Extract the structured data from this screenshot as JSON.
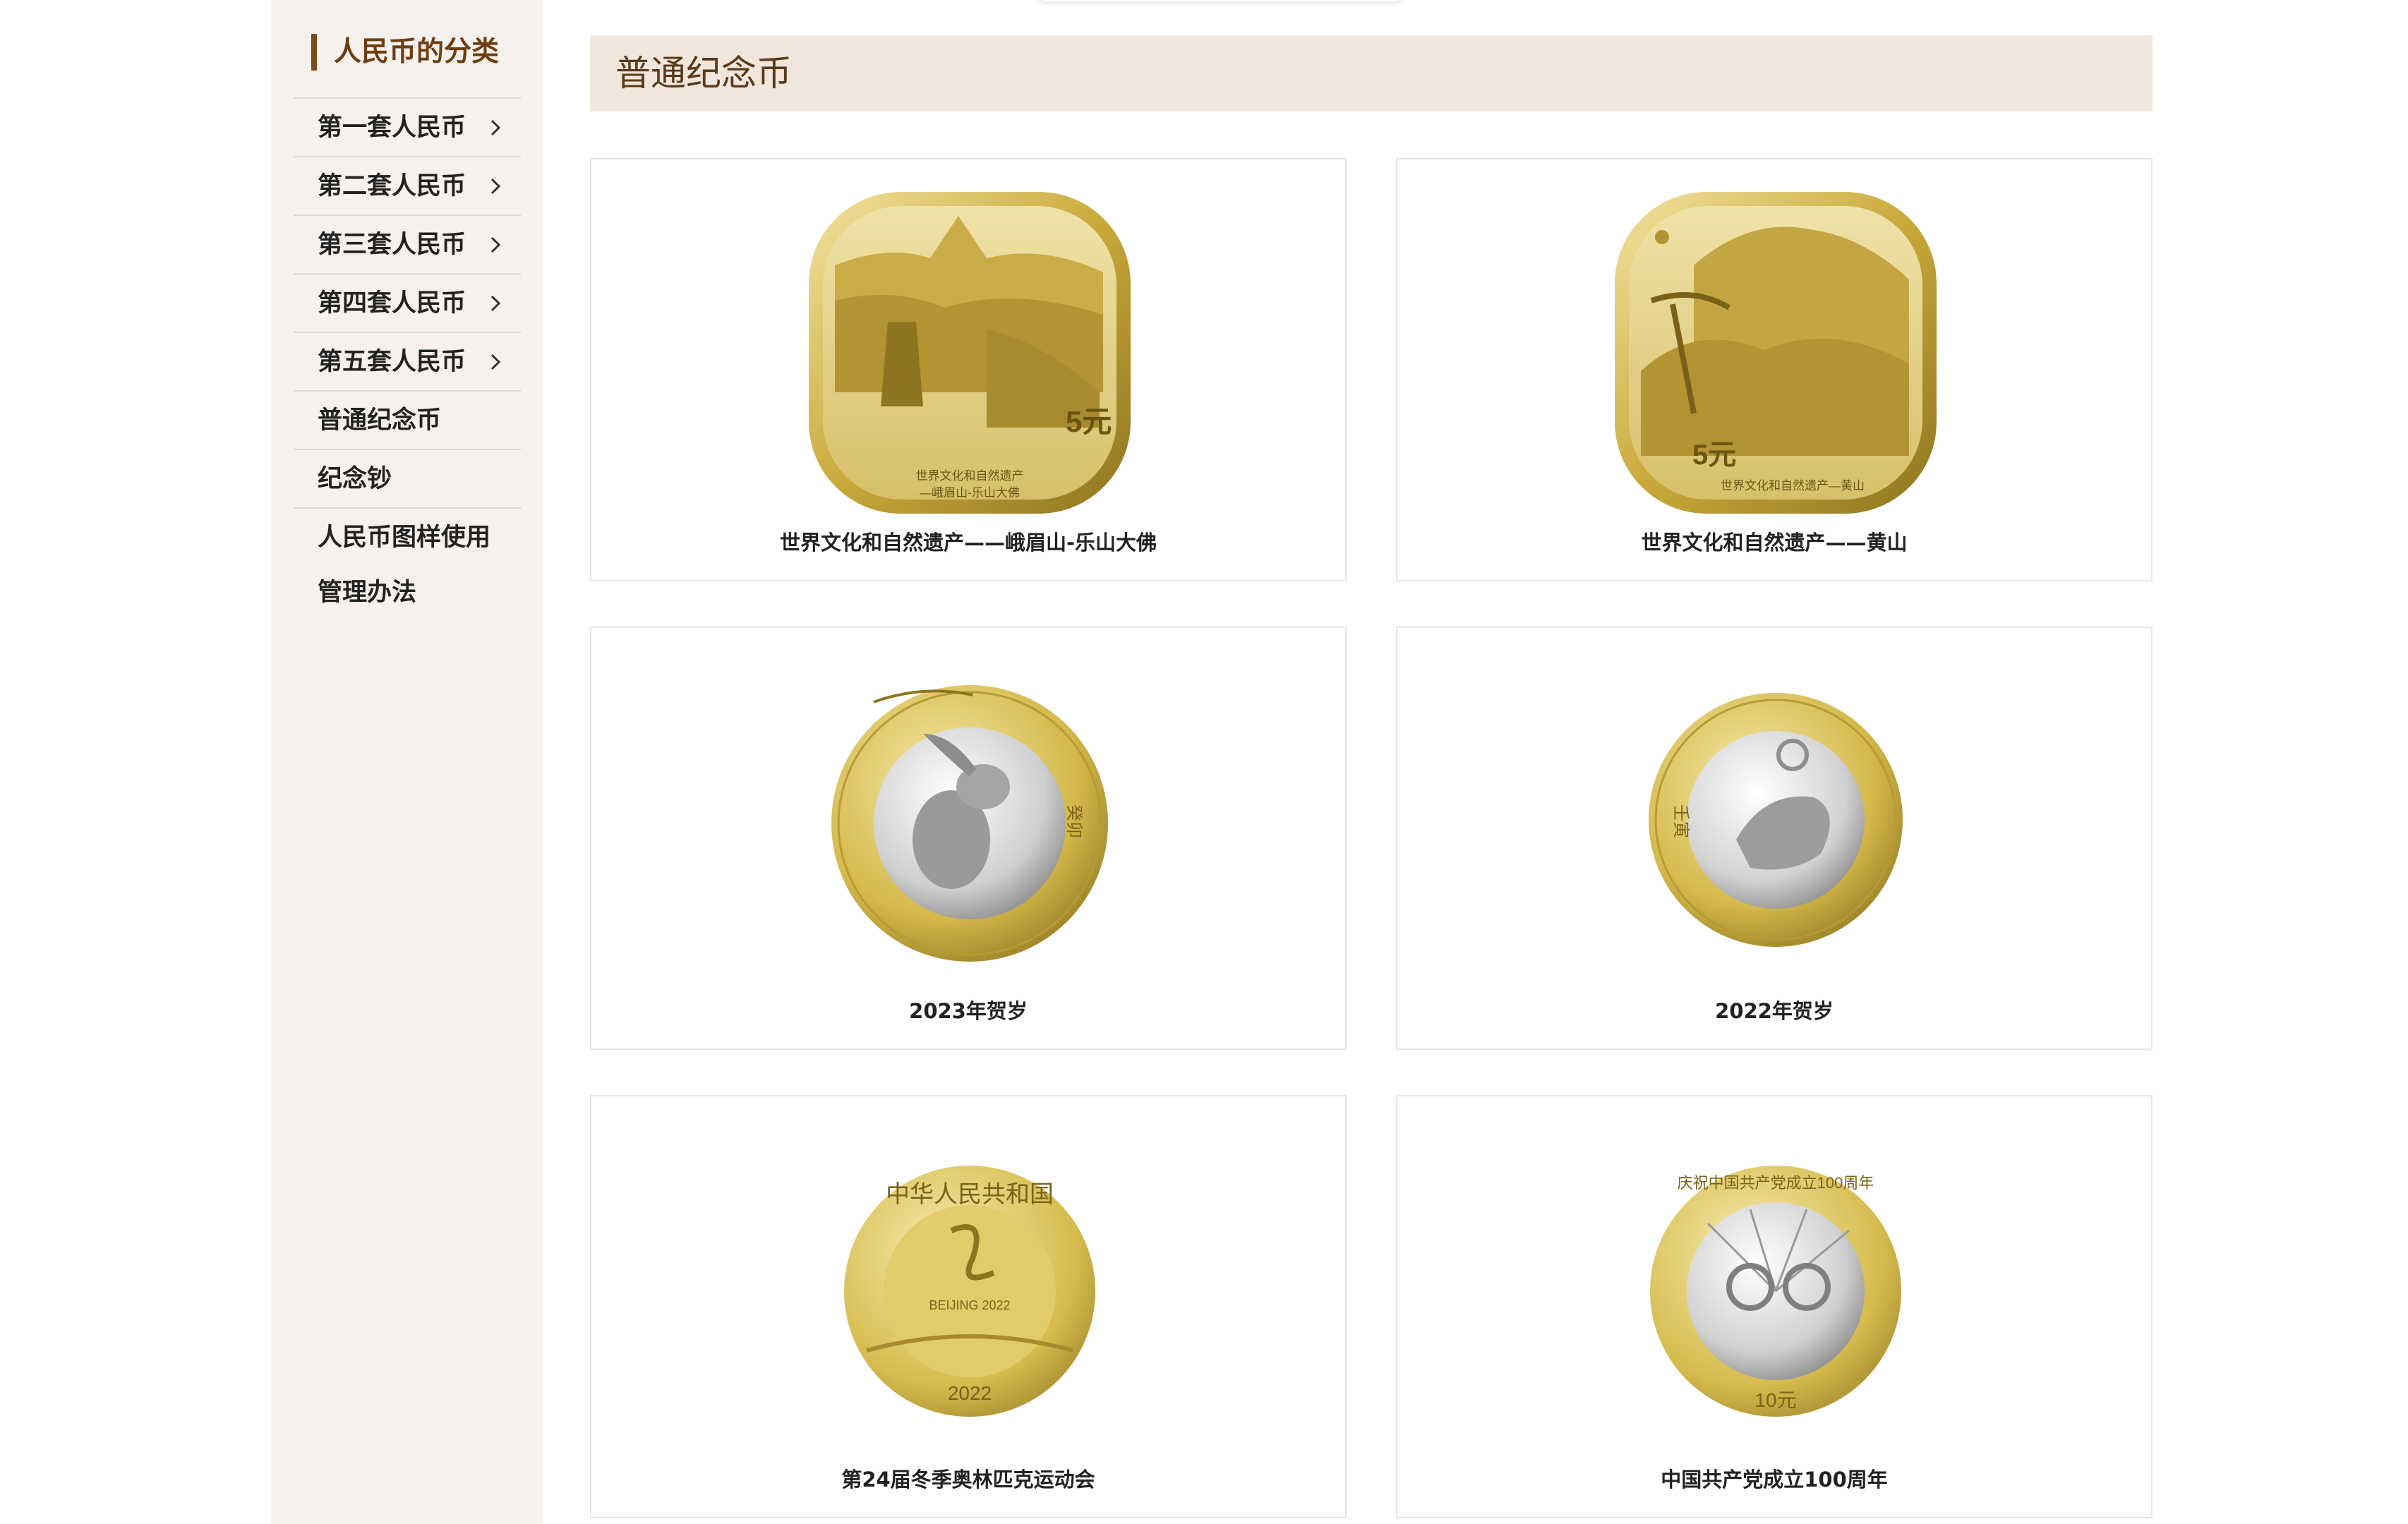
{
  "sidebar": {
    "title": "人民币的分类",
    "items": [
      {
        "label": "第一套人民币",
        "icon": "chevron-right-icon"
      },
      {
        "label": "第二套人民币",
        "icon": "chevron-right-icon"
      },
      {
        "label": "第三套人民币",
        "icon": "chevron-right-icon"
      },
      {
        "label": "第四套人民币",
        "icon": "chevron-right-icon"
      },
      {
        "label": "第五套人民币",
        "icon": "chevron-right-icon"
      },
      {
        "label": "普通纪念币"
      },
      {
        "label": "纪念钞"
      },
      {
        "label_line1": "人民币图样使用",
        "label_line2": "管理办法"
      }
    ]
  },
  "main": {
    "title": "普通纪念币",
    "cards": [
      {
        "caption": "世界文化和自然遗产——峨眉山-乐山大佛",
        "coin": {
          "denomination": "5元",
          "legend": "世界文化和自然遗产",
          "legend2": "—峨眉山-乐山大佛"
        }
      },
      {
        "caption": "世界文化和自然遗产——黄山",
        "coin": {
          "denomination": "5元",
          "legend": "世界文化和自然遗产—黄山"
        }
      },
      {
        "caption": "2023年贺岁",
        "coin": {
          "side_text": "癸卯"
        }
      },
      {
        "caption": "2022年贺岁",
        "coin": {
          "side_text": "壬寅"
        }
      },
      {
        "caption": "第24届冬季奥林匹克运动会",
        "coin": {
          "rim_text": "中华人民共和国",
          "logo_text": "BEIJING 2022",
          "year": "2022"
        }
      },
      {
        "caption": "中国共产党成立100周年",
        "coin": {
          "rim_text": "庆祝中国共产党成立100周年",
          "denomination": "10元"
        }
      }
    ]
  },
  "colors": {
    "sidebar_bg": "#f6f1ec",
    "header_bg": "#f0e6dc",
    "title_accent": "#7a4b18",
    "gold": "#d4b84a",
    "silver": "#c8c8c8"
  }
}
